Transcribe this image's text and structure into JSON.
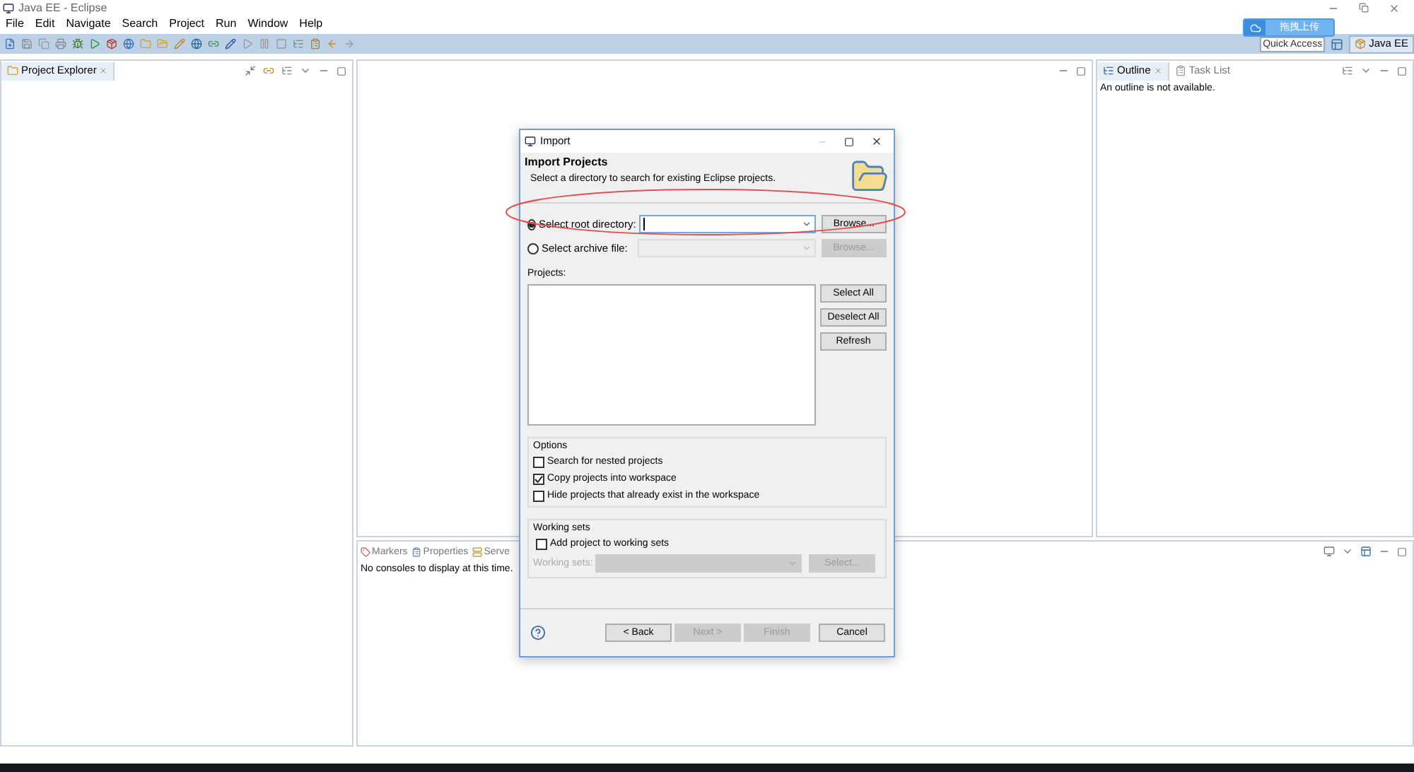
{
  "window": {
    "title": "Java EE - Eclipse"
  },
  "menu": [
    "File",
    "Edit",
    "Navigate",
    "Search",
    "Project",
    "Run",
    "Window",
    "Help"
  ],
  "quick_access": {
    "placeholder": "Quick Access"
  },
  "upload_widget": {
    "label": "拖拽上传"
  },
  "perspective": {
    "label": "Java EE",
    "selected": true
  },
  "project_explorer": {
    "tab": "Project Explorer"
  },
  "outline": {
    "tabs": [
      {
        "label": "Outline",
        "selected": true
      },
      {
        "label": "Task List",
        "selected": false
      }
    ],
    "message": "An outline is not available."
  },
  "console": {
    "tabs": [
      {
        "label": "Markers",
        "kind": "markers"
      },
      {
        "label": "Properties",
        "kind": "properties"
      },
      {
        "label": "Serve",
        "kind": "servers"
      }
    ],
    "message": "No consoles to display at this time."
  },
  "dialog": {
    "title": "Import",
    "heading": "Import Projects",
    "description": "Select a directory to search for existing Eclipse projects.",
    "sources": [
      {
        "label": "Select root directory:",
        "selected": true,
        "browse": "Browse..."
      },
      {
        "label": "Select archive file:",
        "selected": false,
        "browse": "Browse..."
      }
    ],
    "projects_label": "Projects:",
    "list_buttons": [
      "Select All",
      "Deselect All",
      "Refresh"
    ],
    "options": {
      "title": "Options",
      "items": [
        {
          "label": "Search for nested projects",
          "checked": false
        },
        {
          "label": "Copy projects into workspace",
          "checked": true
        },
        {
          "label": "Hide projects that already exist in the workspace",
          "checked": false
        }
      ]
    },
    "working_sets": {
      "title": "Working sets",
      "add": {
        "label": "Add project to working sets",
        "checked": false
      },
      "field_label": "Working sets:",
      "select": "Select...",
      "disabled": true
    },
    "footer_buttons": [
      {
        "label": "< Back",
        "disabled": false
      },
      {
        "label": "Next >",
        "disabled": true
      },
      {
        "label": "Finish",
        "disabled": true
      },
      {
        "label": "Cancel",
        "disabled": false
      }
    ]
  },
  "annotation": {
    "kind": "ellipse",
    "color": "#e05050"
  }
}
